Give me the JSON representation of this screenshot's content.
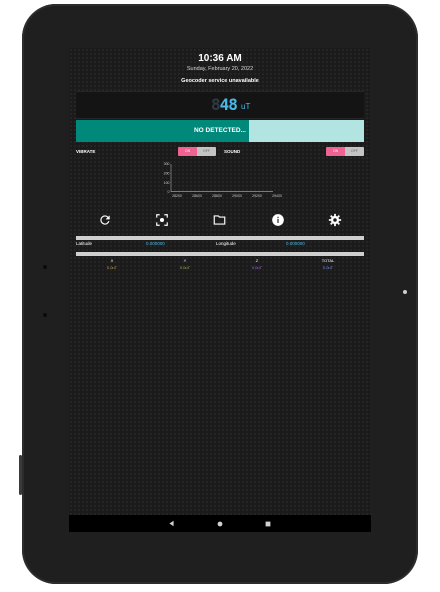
{
  "status": {
    "time": "10:36 AM",
    "date": "Sunday, February 20, 2022",
    "geocoder": "Geocoder service unavailable"
  },
  "reading": {
    "ghost_digit": "8",
    "value": "48",
    "unit": "uT"
  },
  "detector": {
    "text": "NO DETECTED...",
    "fill_fraction": 0.6
  },
  "settings": {
    "vibrate_label": "VIBRATE",
    "sound_label": "SOUND",
    "on_label": "ON",
    "off_label": "OFF"
  },
  "chart_data": {
    "type": "line",
    "y_ticks": [
      "300",
      "200",
      "100",
      "0"
    ],
    "x_ticks": [
      "28200",
      "28600",
      "28800",
      "29000",
      "29200",
      "29400"
    ],
    "series": [
      {
        "values": [
          0,
          0,
          0,
          0,
          0,
          0
        ]
      }
    ]
  },
  "toolbar": {
    "icons": [
      "refresh-icon",
      "screenshot-icon",
      "folder-icon",
      "info-icon",
      "settings-gear-icon"
    ]
  },
  "location": {
    "lat_label": "Latitude",
    "lat_value": "0.000000",
    "lon_label": "Longitude",
    "lon_value": "0.000000"
  },
  "axes": {
    "x_label": "X",
    "y_label": "Y",
    "z_label": "Z",
    "total_label": "TOTAL",
    "x_value": "0.0uT",
    "y_value": "0.0uT",
    "z_value": "0.0uT",
    "total_value": "0.0uT",
    "colors": {
      "x": "#c8a040",
      "y": "#b0b060",
      "z": "#a070e0",
      "total": "#7a90ff"
    }
  },
  "colors": {
    "accent": "#00897b",
    "accent_light": "#b2e4e1",
    "lcd": "#49b9e8",
    "toggle_on": "#f06292"
  }
}
